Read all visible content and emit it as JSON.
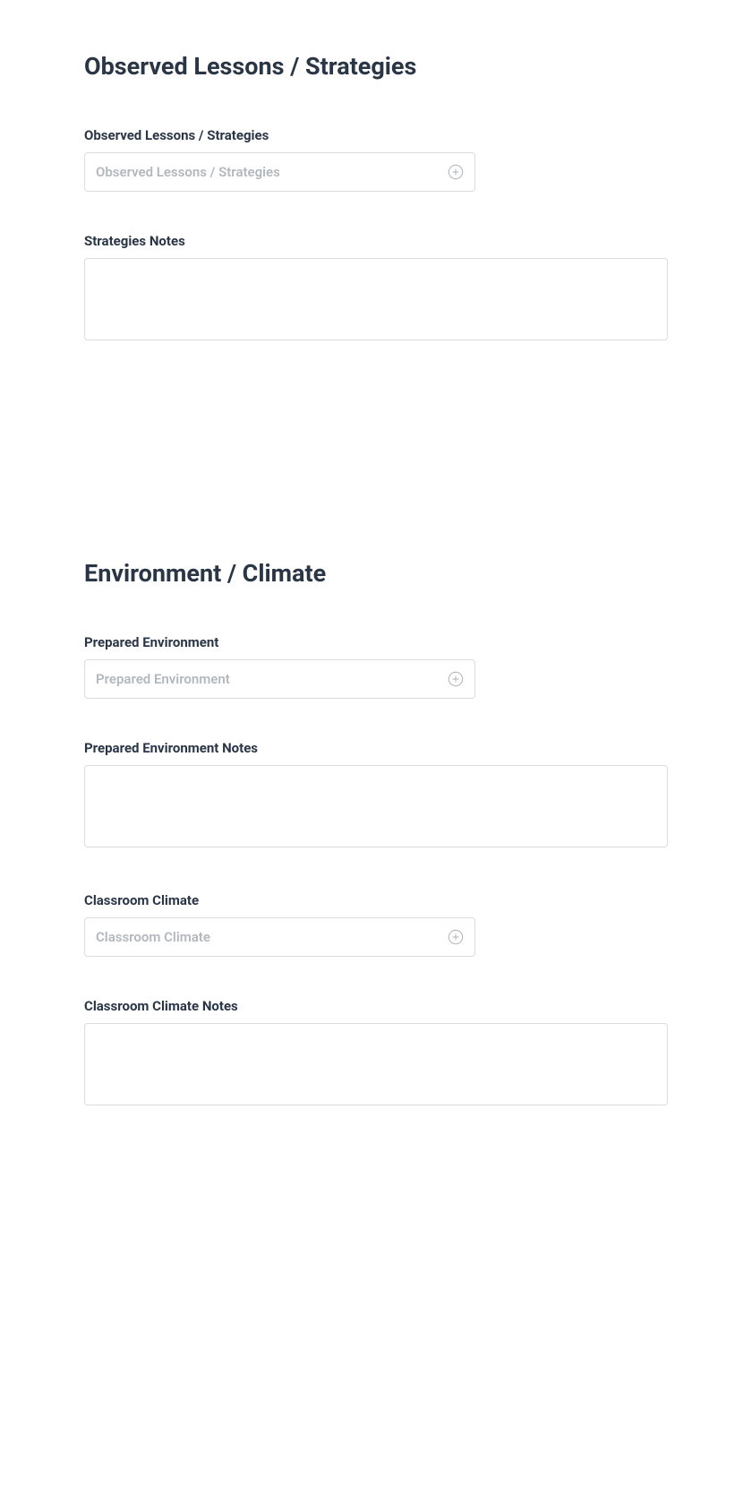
{
  "sections": {
    "observed": {
      "heading": "Observed Lessons / Strategies",
      "fields": {
        "strategies": {
          "label": "Observed Lessons / Strategies",
          "placeholder": "Observed Lessons / Strategies"
        },
        "strategies_notes": {
          "label": "Strategies Notes",
          "value": ""
        }
      }
    },
    "environment": {
      "heading": "Environment / Climate",
      "fields": {
        "prepared_env": {
          "label": "Prepared Environment",
          "placeholder": "Prepared Environment"
        },
        "prepared_env_notes": {
          "label": "Prepared Environment Notes",
          "value": ""
        },
        "classroom_climate": {
          "label": "Classroom Climate",
          "placeholder": "Classroom Climate"
        },
        "classroom_climate_notes": {
          "label": "Classroom Climate Notes",
          "value": ""
        }
      }
    }
  }
}
